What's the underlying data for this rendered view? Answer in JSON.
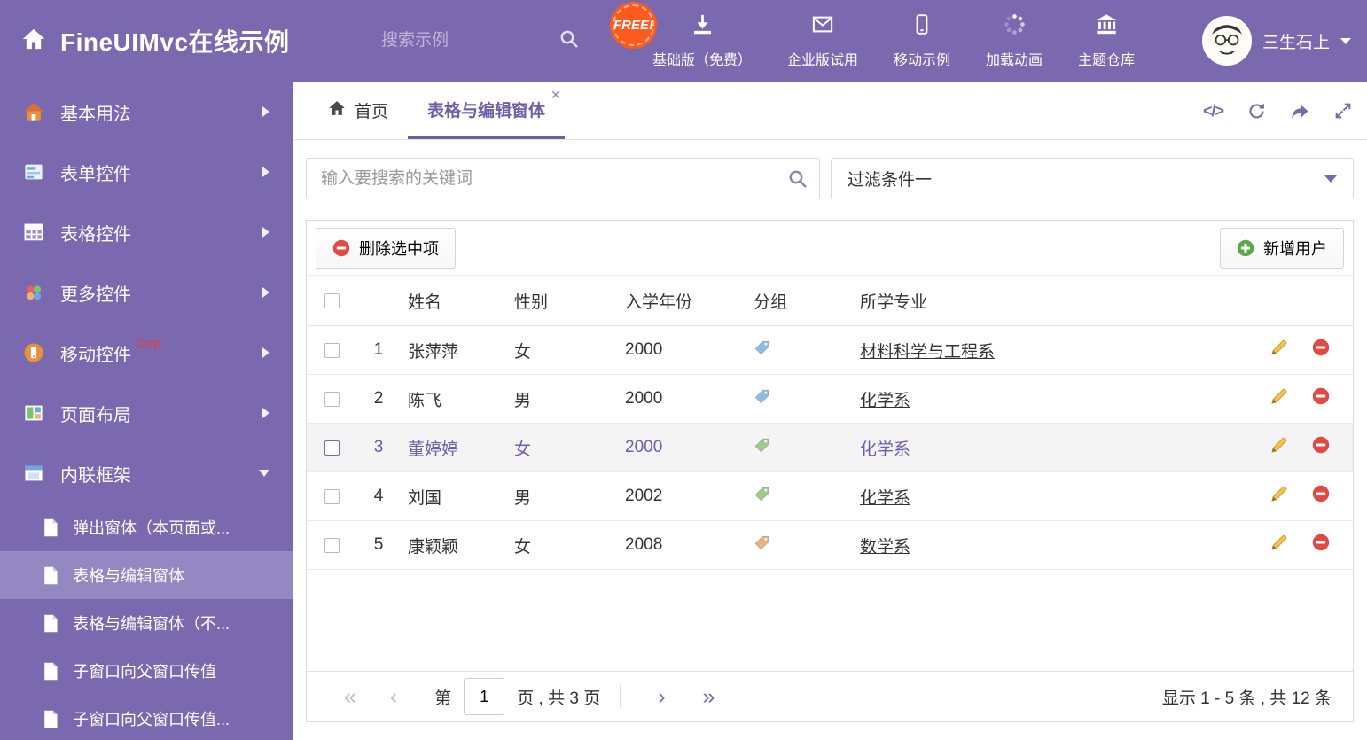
{
  "header": {
    "title": "FineUIMvc在线示例",
    "search_placeholder": "搜索示例",
    "free_badge": "FREE!",
    "nav_items": [
      {
        "label": "基础版（免费）",
        "icon": "download-icon"
      },
      {
        "label": "企业版试用",
        "icon": "envelope-icon"
      },
      {
        "label": "移动示例",
        "icon": "mobile-icon"
      },
      {
        "label": "加载动画",
        "icon": "spinner-icon"
      },
      {
        "label": "主题仓库",
        "icon": "bank-icon"
      }
    ],
    "user": {
      "name": "三生石上",
      "icon": "avatar"
    }
  },
  "sidebar": {
    "items": [
      {
        "label": "基本用法",
        "icon": "home-icon"
      },
      {
        "label": "表单控件",
        "icon": "form-icon"
      },
      {
        "label": "表格控件",
        "icon": "table-icon"
      },
      {
        "label": "更多控件",
        "icon": "widgets-icon"
      },
      {
        "label": "移动控件",
        "badge": "Corp.",
        "icon": "mobile-circle-icon"
      },
      {
        "label": "页面布局",
        "icon": "layout-icon"
      },
      {
        "label": "内联框架",
        "icon": "iframe-icon",
        "expanded": true
      }
    ],
    "subitems": [
      {
        "label": "弹出窗体（本页面或...",
        "active": false
      },
      {
        "label": "表格与编辑窗体",
        "active": true
      },
      {
        "label": "表格与编辑窗体（不...",
        "active": false
      },
      {
        "label": "子窗口向父窗口传值",
        "active": false
      },
      {
        "label": "子窗口向父窗口传值...",
        "active": false
      }
    ]
  },
  "tabbar": {
    "tabs": [
      {
        "label": "首页",
        "icon": "home-icon",
        "active": false
      },
      {
        "label": "表格与编辑窗体",
        "active": true,
        "closable": true
      }
    ],
    "tools": [
      "code-icon",
      "refresh-icon",
      "forward-icon",
      "expand-icon"
    ]
  },
  "filters": {
    "search_placeholder": "输入要搜索的关键词",
    "dropdown_value": "过滤条件一"
  },
  "toolbar": {
    "delete_label": "删除选中项",
    "add_label": "新增用户"
  },
  "table": {
    "columns": [
      "姓名",
      "性别",
      "入学年份",
      "分组",
      "所学专业"
    ],
    "rows": [
      {
        "num": "1",
        "name": "张萍萍",
        "gender": "女",
        "year": "2000",
        "tag_color": "#85c1ea",
        "major": "材料科学与工程系",
        "selected": false
      },
      {
        "num": "2",
        "name": "陈飞",
        "gender": "男",
        "year": "2000",
        "tag_color": "#85c1ea",
        "major": "化学系",
        "selected": false
      },
      {
        "num": "3",
        "name": "董婷婷",
        "gender": "女",
        "year": "2000",
        "tag_color": "#9bce85",
        "major": "化学系",
        "selected": true
      },
      {
        "num": "4",
        "name": "刘国",
        "gender": "男",
        "year": "2002",
        "tag_color": "#9bce85",
        "major": "化学系",
        "selected": false
      },
      {
        "num": "5",
        "name": "康颖颖",
        "gender": "女",
        "year": "2008",
        "tag_color": "#f2b077",
        "major": "数学系",
        "selected": false
      }
    ]
  },
  "pagination": {
    "page_prefix": "第",
    "current_page": "1",
    "page_suffix": "页 , 共 3 页",
    "summary": "显示 1 - 5 条 , 共 12 条"
  },
  "colors": {
    "accent": "#7a69ae",
    "selected_text": "#6e5da8",
    "danger": "#e04a42",
    "success": "#58aa48",
    "free_badge_bg": "#ff5a1e",
    "corp_badge": "#ff2d1f"
  }
}
